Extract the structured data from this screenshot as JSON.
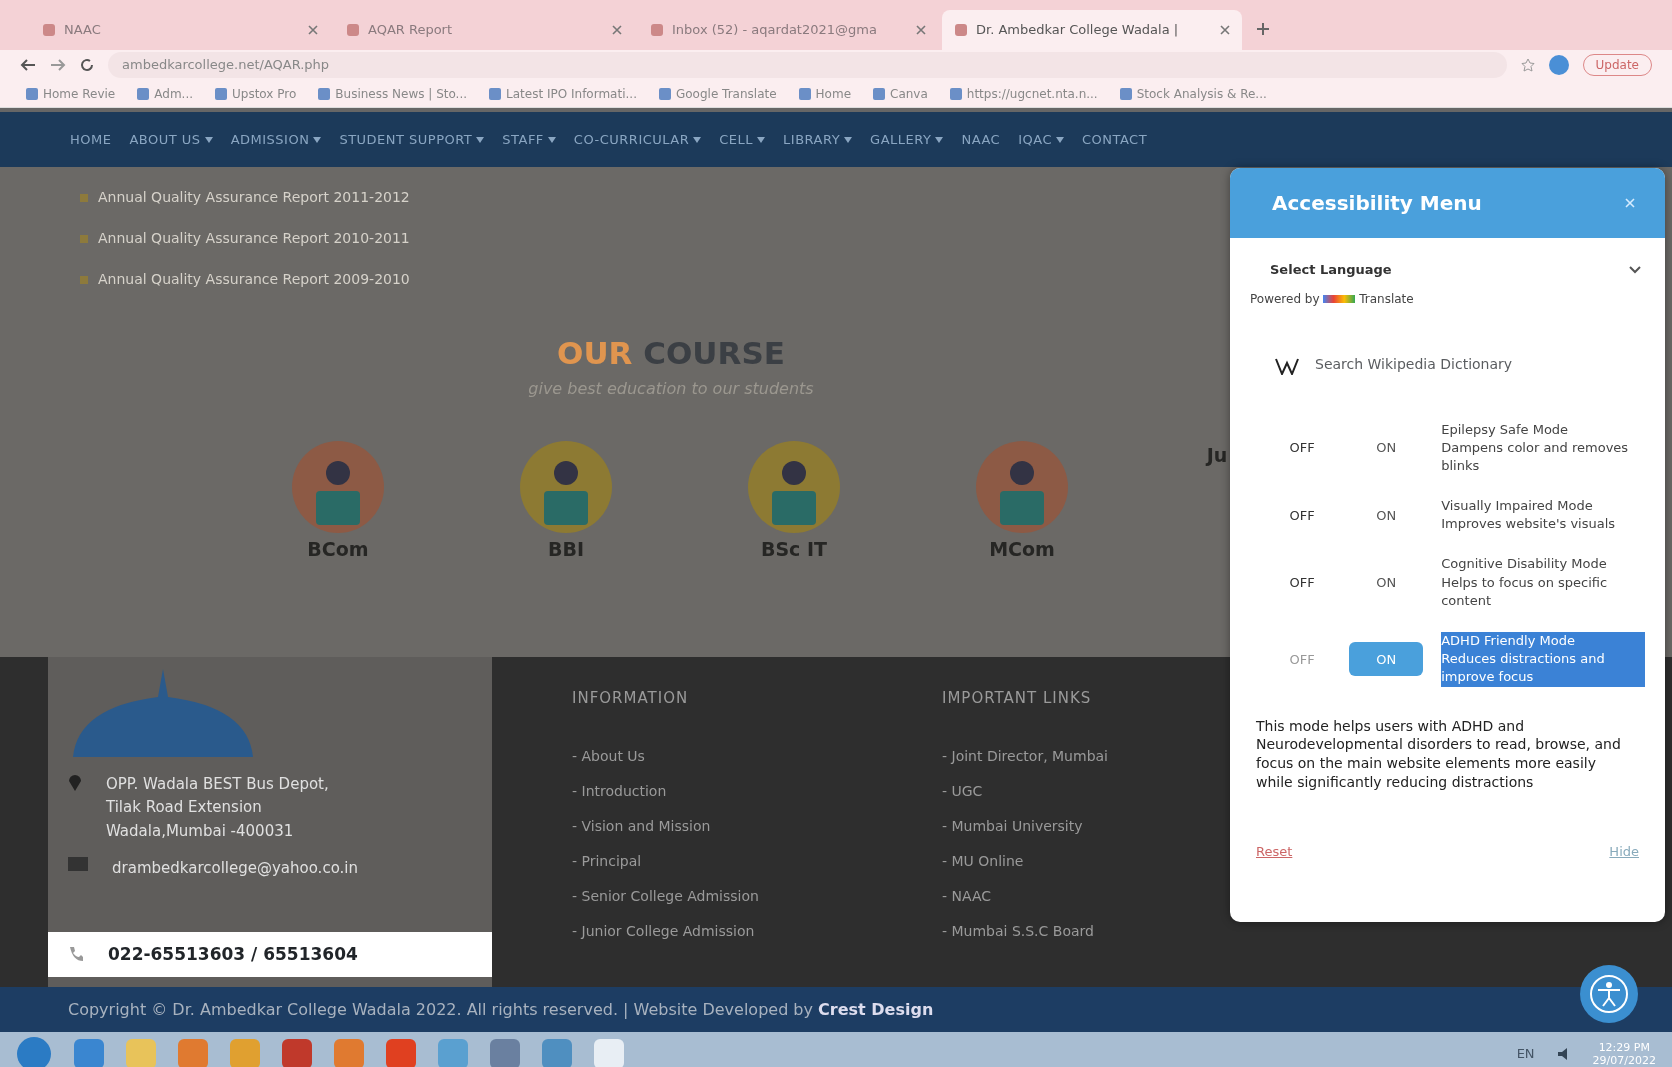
{
  "browser": {
    "tabs": [
      {
        "title": "NAAC",
        "selected": false
      },
      {
        "title": "AQAR Report",
        "selected": false
      },
      {
        "title": "Inbox (52) - aqardat2021@gma",
        "selected": false
      },
      {
        "title": "Dr. Ambedkar College Wadala |",
        "selected": true
      }
    ],
    "url": "ambedkarcollege.net/AQAR.php",
    "update_button": "Update",
    "bookmarks": [
      "Home Revie",
      "Adm...",
      "Upstox Pro",
      "Business News | Sto...",
      "Latest IPO Informati...",
      "Google Translate",
      "Home",
      "Canva",
      "https://ugcnet.nta.n...",
      "Stock Analysis & Re..."
    ]
  },
  "nav": [
    {
      "label": "HOME",
      "dropdown": false
    },
    {
      "label": "ABOUT US",
      "dropdown": true
    },
    {
      "label": "ADMISSION",
      "dropdown": true
    },
    {
      "label": "STUDENT SUPPORT",
      "dropdown": true
    },
    {
      "label": "STAFF",
      "dropdown": true
    },
    {
      "label": "CO-CURRICULAR",
      "dropdown": true
    },
    {
      "label": "CELL",
      "dropdown": true
    },
    {
      "label": "LIBRARY",
      "dropdown": true
    },
    {
      "label": "GALLERY",
      "dropdown": true
    },
    {
      "label": "NAAC",
      "dropdown": false
    },
    {
      "label": "IQAC",
      "dropdown": true
    },
    {
      "label": "CONTACT",
      "dropdown": false
    }
  ],
  "reports": [
    "Annual Quality Assurance Report 2011-2012",
    "Annual Quality Assurance Report 2010-2011",
    "Annual Quality Assurance Report 2009-2010"
  ],
  "courses_section": {
    "title_accent": "OUR",
    "title": "COURSE",
    "subtitle": "give best education to our students",
    "courses": [
      "BCom",
      "BBI",
      "BSc IT",
      "MCom",
      "Ju"
    ]
  },
  "footer": {
    "address": "OPP. Wadala BEST Bus Depot, Tilak Road Extension Wadala,Mumbai -400031",
    "email": "drambedkarcollege@yahoo.co.in",
    "phone": "022-65513603 / 65513604",
    "information_title": "INFORMATION",
    "information": [
      "- About Us",
      "- Introduction",
      "- Vision and Mission",
      "- Principal",
      "- Senior College Admission",
      "- Junior College Admission"
    ],
    "links_title": "IMPORTANT LINKS",
    "links": [
      "- Joint Director, Mumbai",
      "- UGC",
      "- Mumbai University",
      "- MU Online",
      "- NAAC",
      "- Mumbai S.S.C Board"
    ],
    "copyright": "Copyright © Dr. Ambedkar College Wadala 2022. All rights reserved. | Website Developed by ",
    "developer": "Crest Design"
  },
  "accessibility_menu": {
    "title": "Accessibility Menu",
    "language": "Select Language",
    "powered_by": "Powered by",
    "translate": "Translate",
    "search_placeholder": "Search Wikipedia Dictionary",
    "modes": [
      {
        "off": "OFF",
        "on_label": "ON",
        "on": false,
        "title": "Epilepsy Safe Mode",
        "description": "Dampens color and removes blinks",
        "highlighted": false
      },
      {
        "off": "OFF",
        "on_label": "ON",
        "on": false,
        "title": "Visually Impaired Mode",
        "description": "Improves website's visuals",
        "highlighted": false
      },
      {
        "off": "OFF",
        "on_label": "ON",
        "on": false,
        "title": "Cognitive Disability Mode",
        "description": "Helps to focus on specific content",
        "highlighted": false
      },
      {
        "off": "OFF",
        "on_label": "ON",
        "on": true,
        "title": "ADHD Friendly Mode",
        "description": "Reduces distractions and improve focus",
        "highlighted": true
      }
    ],
    "info": "This mode helps users with ADHD and Neurodevelopmental disorders to read, browse, and focus on the main website elements more easily while significantly reducing distractions",
    "reset": "Reset",
    "hide": "Hide"
  },
  "taskbar": {
    "language": "EN",
    "time": "12:29 PM",
    "date": "29/07/2022"
  }
}
